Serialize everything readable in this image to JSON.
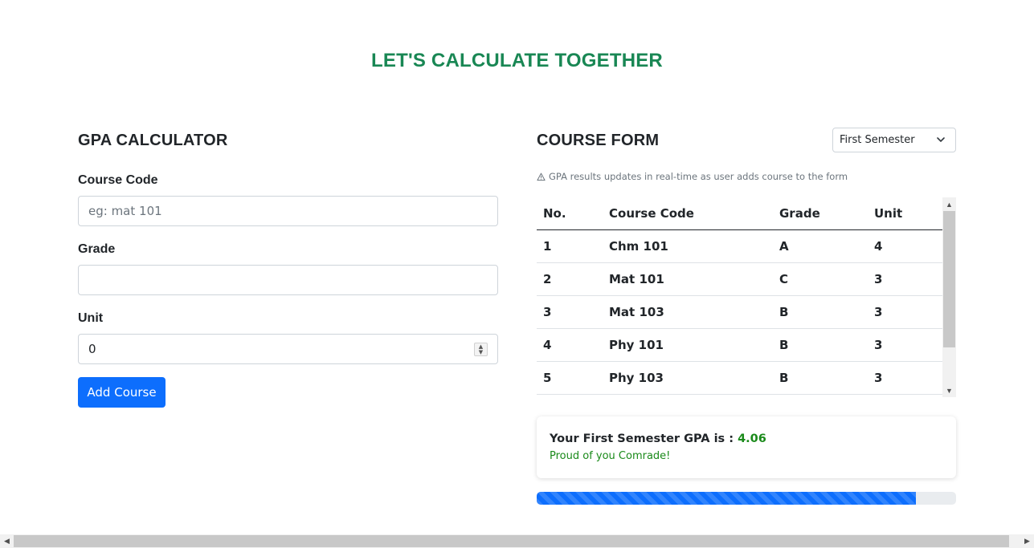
{
  "page": {
    "title": "LET'S CALCULATE TOGETHER"
  },
  "calculator": {
    "heading": "GPA CALCULATOR",
    "course_code": {
      "label": "Course Code",
      "value": "",
      "placeholder": "eg: mat 101"
    },
    "grade": {
      "label": "Grade",
      "value": ""
    },
    "unit": {
      "label": "Unit",
      "value": "0"
    },
    "add_button": "Add Course"
  },
  "course_form": {
    "heading": "COURSE FORM",
    "semester_select": {
      "selected": "First Semester"
    },
    "note": "GPA results updates in real-time as user adds course to the form",
    "columns": [
      "No.",
      "Course Code",
      "Grade",
      "Unit"
    ],
    "rows": [
      [
        "1",
        "Chm 101",
        "A",
        "4"
      ],
      [
        "2",
        "Mat 101",
        "C",
        "3"
      ],
      [
        "3",
        "Mat 103",
        "B",
        "3"
      ],
      [
        "4",
        "Phy 101",
        "B",
        "3"
      ],
      [
        "5",
        "Phy 103",
        "B",
        "3"
      ]
    ]
  },
  "result": {
    "gpa_prefix": "Your First Semester GPA is : ",
    "gpa_value": "4.06",
    "remark": "Proud of you Comrade!"
  },
  "progress": {
    "percent": 90.5
  },
  "colors": {
    "accent": "#0d6efd",
    "success": "#198754",
    "gpa_green": "#1a8a1a"
  },
  "icons": {
    "select": "chevron-down-icon",
    "note": "warning-triangle-icon"
  }
}
